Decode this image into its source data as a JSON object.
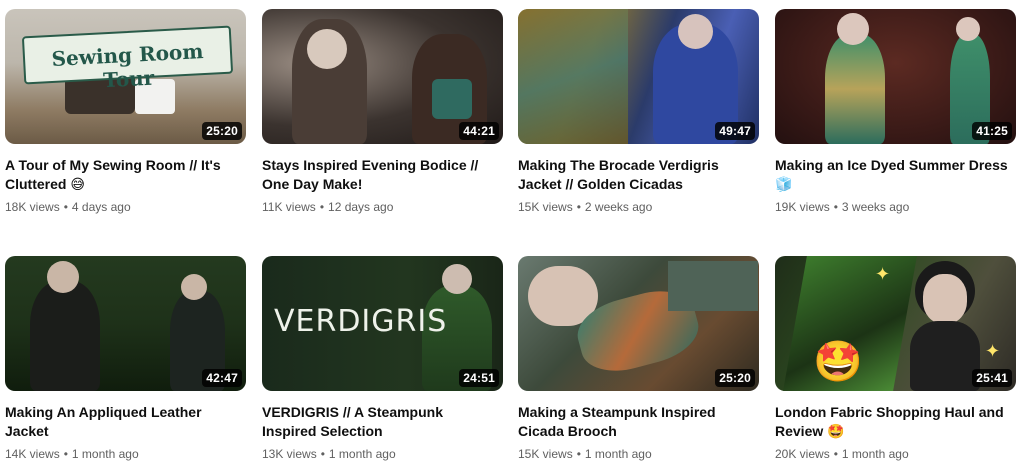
{
  "videos": [
    {
      "title": "A Tour of My Sewing Room // It's Cluttered 😅",
      "duration": "25:20",
      "views": "18K views",
      "age": "4 days ago",
      "thumb_text": "Sewing Room Tour"
    },
    {
      "title": "Stays Inspired Evening Bodice // One Day Make!",
      "duration": "44:21",
      "views": "11K views",
      "age": "12 days ago"
    },
    {
      "title": "Making The Brocade Verdigris Jacket // Golden Cicadas",
      "duration": "49:47",
      "views": "15K views",
      "age": "2 weeks ago"
    },
    {
      "title": "Making an Ice Dyed Summer Dress 🧊",
      "duration": "41:25",
      "views": "19K views",
      "age": "3 weeks ago"
    },
    {
      "title": "Making An Appliqued Leather Jacket",
      "duration": "42:47",
      "views": "14K views",
      "age": "1 month ago"
    },
    {
      "title": "VERDIGRIS // A Steampunk Inspired Selection",
      "duration": "24:51",
      "views": "13K views",
      "age": "1 month ago",
      "thumb_text": "VERDIGRIS"
    },
    {
      "title": "Making a Steampunk Inspired Cicada Brooch",
      "duration": "25:20",
      "views": "15K views",
      "age": "1 month ago"
    },
    {
      "title": "London Fabric Shopping Haul and Review 🤩",
      "duration": "25:41",
      "views": "20K views",
      "age": "1 month ago"
    }
  ],
  "separator": "•",
  "colors": {
    "meta_text": "#606060",
    "title_text": "#0f0f0f",
    "duration_bg": "#000000"
  }
}
